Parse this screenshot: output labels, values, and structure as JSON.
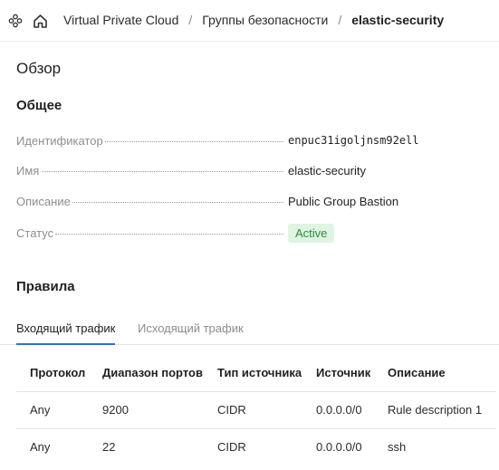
{
  "header": {
    "icons": [
      "services-icon",
      "home-icon"
    ],
    "breadcrumb": [
      "Virtual Private Cloud",
      "Группы безопасности",
      "elastic-security"
    ],
    "separator": "/"
  },
  "overview": {
    "title": "Обзор",
    "general_title": "Общее",
    "properties": [
      {
        "key": "Идентификатор",
        "value": "enpuc31igoljnsm92ell"
      },
      {
        "key": "Имя",
        "value": "elastic-security"
      },
      {
        "key": "Описание",
        "value": "Public Group Bastion"
      },
      {
        "key": "Статус",
        "value": "Active"
      }
    ],
    "status_color": "#2e8a3e"
  },
  "rules": {
    "title": "Правила",
    "tabs": [
      {
        "label": "Входящий трафик",
        "active": true
      },
      {
        "label": "Исходящий трафик",
        "active": false
      }
    ],
    "columns": [
      "Протокол",
      "Диапазон портов",
      "Тип источника",
      "Источник",
      "Описание"
    ],
    "rows": [
      [
        "Any",
        "9200",
        "CIDR",
        "0.0.0.0/0",
        "Rule description 1"
      ],
      [
        "Any",
        "22",
        "CIDR",
        "0.0.0.0/0",
        "ssh"
      ]
    ]
  },
  "accent_color": "#2f6fd6"
}
